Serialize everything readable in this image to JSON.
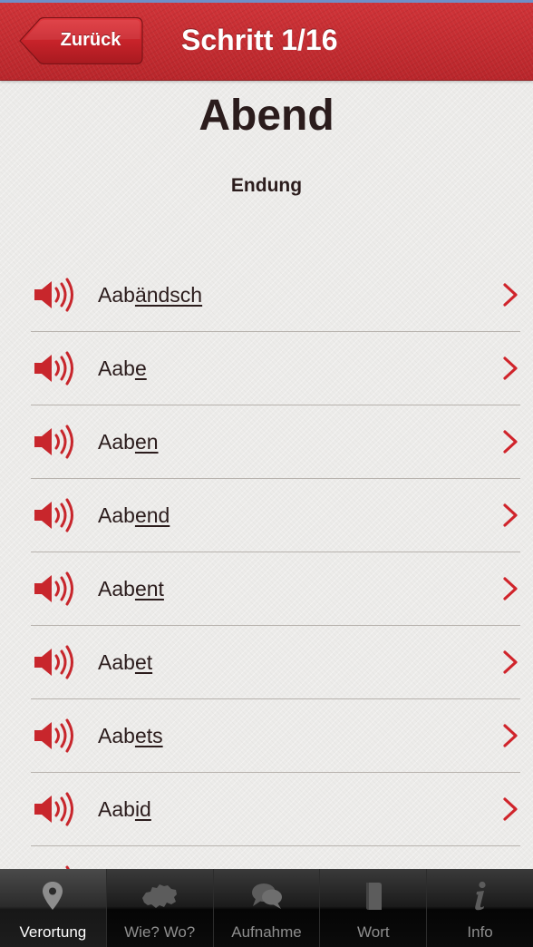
{
  "colors": {
    "accent_red": "#c22a2f",
    "text_dark": "#2b1c1c",
    "tab_bar_bg": "#1b1b1b"
  },
  "nav": {
    "back_label": "Zurück",
    "title": "Schritt 1/16"
  },
  "page": {
    "heading": "Abend",
    "subheading": "Endung"
  },
  "rows": [
    {
      "stem": "Aab",
      "ending": "ändsch",
      "icon": "speaker-icon"
    },
    {
      "stem": "Aab",
      "ending": "e",
      "icon": "speaker-icon"
    },
    {
      "stem": "Aab",
      "ending": "en",
      "icon": "speaker-icon"
    },
    {
      "stem": "Aab",
      "ending": "end",
      "icon": "speaker-icon"
    },
    {
      "stem": "Aab",
      "ending": "ent",
      "icon": "speaker-icon"
    },
    {
      "stem": "Aab",
      "ending": "et",
      "icon": "speaker-icon"
    },
    {
      "stem": "Aab",
      "ending": "ets",
      "icon": "speaker-icon"
    },
    {
      "stem": "Aab",
      "ending": "id",
      "icon": "speaker-icon"
    },
    {
      "stem": "",
      "ending": "",
      "icon": "speaker-icon"
    }
  ],
  "tabs": [
    {
      "label": "Verortung",
      "icon": "location-pin-icon",
      "selected": true
    },
    {
      "label": "Wie? Wo?",
      "icon": "switzerland-map-icon",
      "selected": false
    },
    {
      "label": "Aufnahme",
      "icon": "speech-bubbles-icon",
      "selected": false
    },
    {
      "label": "Wort",
      "icon": "book-icon",
      "selected": false
    },
    {
      "label": "Info",
      "icon": "info-icon",
      "selected": false
    }
  ]
}
